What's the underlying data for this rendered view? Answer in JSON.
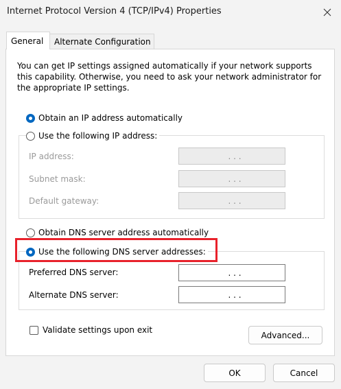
{
  "window": {
    "title": "Internet Protocol Version 4 (TCP/IPv4) Properties",
    "close_icon": "close-icon"
  },
  "tabs": [
    {
      "label": "General",
      "selected": true
    },
    {
      "label": "Alternate Configuration",
      "selected": false
    }
  ],
  "description": "You can get IP settings assigned automatically if your network supports this capability. Otherwise, you need to ask your network administrator for the appropriate IP settings.",
  "ip": {
    "auto_label": "Obtain an IP address automatically",
    "manual_label": "Use the following IP address:",
    "selected": "auto",
    "fields": [
      {
        "label": "IP address:",
        "value": ". . ."
      },
      {
        "label": "Subnet mask:",
        "value": ". . ."
      },
      {
        "label": "Default gateway:",
        "value": ". . ."
      }
    ]
  },
  "dns": {
    "auto_label": "Obtain DNS server address automatically",
    "manual_label": "Use the following DNS server addresses:",
    "selected": "manual",
    "fields": [
      {
        "label": "Preferred DNS server:",
        "value": ". . ."
      },
      {
        "label": "Alternate DNS server:",
        "value": ". . ."
      }
    ]
  },
  "validate_label": "Validate settings upon exit",
  "buttons": {
    "advanced": "Advanced...",
    "ok": "OK",
    "cancel": "Cancel"
  },
  "colors": {
    "accent": "#0067c0",
    "highlight": "#e8212b"
  }
}
